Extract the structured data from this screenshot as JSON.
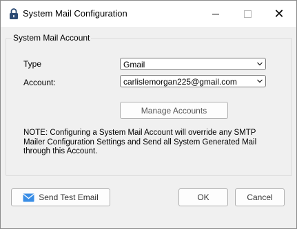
{
  "window": {
    "title": "System Mail Configuration",
    "close_glyph": "✕"
  },
  "group": {
    "label": "System Mail Account"
  },
  "form": {
    "type_label": "Type",
    "type_value": "Gmail",
    "account_label": "Account:",
    "account_value": "carlislemorgan225@gmail.com"
  },
  "buttons": {
    "manage_accounts": "Manage Accounts",
    "send_test_email": "Send Test Email",
    "ok": "OK",
    "cancel": "Cancel"
  },
  "note": "NOTE:  Configuring a System Mail Account will override any SMTP Mailer Configuration Settings and Send all System Generated Mail through this Account.",
  "icons": {
    "title": "lock-icon",
    "mail": "envelope-icon",
    "dropdown": "chevron-down-icon"
  },
  "colors": {
    "envelope": "#3a8ee6",
    "lock": "#2b4a74"
  }
}
